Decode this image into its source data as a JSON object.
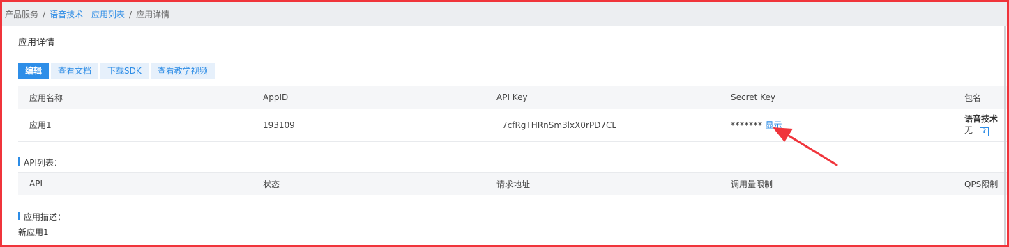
{
  "breadcrumb": {
    "root": "产品服务",
    "separator": "/",
    "middle": "语音技术 - 应用列表",
    "current": "应用详情"
  },
  "page": {
    "title": "应用详情"
  },
  "toolbar": {
    "edit_label": "编辑",
    "docs_label": "查看文档",
    "sdk_label": "下载SDK",
    "video_label": "查看教学视频"
  },
  "app_table": {
    "headers": [
      "应用名称",
      "AppID",
      "API Key",
      "Secret Key",
      "包名"
    ],
    "row": {
      "name": "应用1",
      "app_id": "193109",
      "api_key": "7cfRgTHRnSm3lxX0rPD7CL",
      "secret_masked": "*******",
      "show_label": "显示",
      "package_name": "语音技术",
      "package_value": "无",
      "help_symbol": "?"
    }
  },
  "api_section": {
    "label": "API列表：",
    "headers": [
      "API",
      "状态",
      "请求地址",
      "调用量限制",
      "QPS限制"
    ]
  },
  "desc_section": {
    "label": "应用描述：",
    "text": "新应用1"
  },
  "colors": {
    "accent": "#2c8ce6",
    "primary_button": "#2e8ee8",
    "annotation": "#f0343b"
  }
}
